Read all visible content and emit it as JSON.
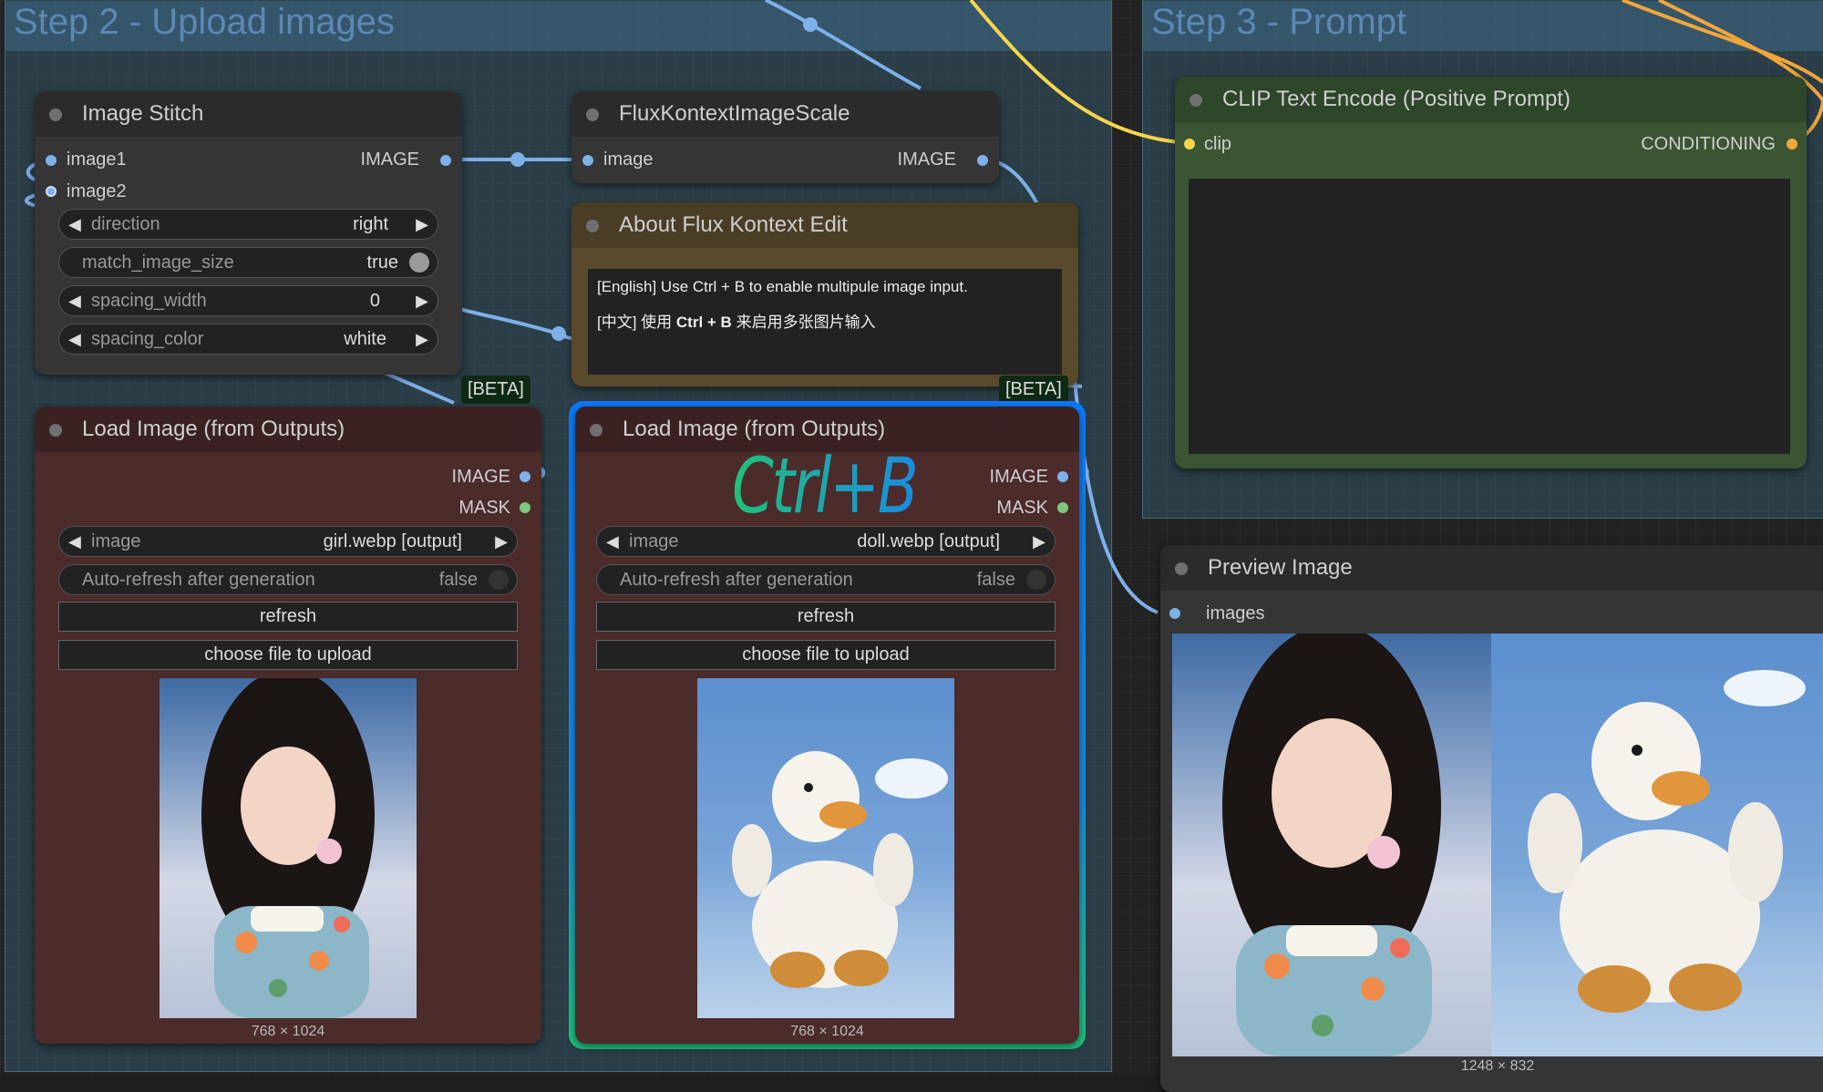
{
  "groups": {
    "step2_title": "Step 2 - Upload images",
    "step3_title": "Step 3 - Prompt"
  },
  "image_stitch": {
    "title": "Image Stitch",
    "inputs": [
      "image1",
      "image2"
    ],
    "output": "IMAGE",
    "widgets": [
      {
        "label": "direction",
        "value": "right"
      },
      {
        "label": "match_image_size",
        "value": "true"
      },
      {
        "label": "spacing_width",
        "value": "0"
      },
      {
        "label": "spacing_color",
        "value": "white"
      }
    ]
  },
  "flux_scale": {
    "title": "FluxKontextImageScale",
    "input": "image",
    "output": "IMAGE"
  },
  "about_note": {
    "title": "About Flux Kontext Edit",
    "line_en": "[English] Use Ctrl + B to enable multipule image input.",
    "line_zh_prefix": "[中文] 使用 ",
    "line_zh_bold": "Ctrl + B",
    "line_zh_suffix": " 来启用多张图片输入"
  },
  "beta_badge": "[BETA]",
  "load_left": {
    "title": "Load Image (from Outputs)",
    "out_image": "IMAGE",
    "out_mask": "MASK",
    "image_label": "image",
    "image_value": "girl.webp [output]",
    "autorefresh_label": "Auto-refresh after generation",
    "autorefresh_value": "false",
    "refresh_label": "refresh",
    "upload_label": "choose file to upload",
    "dims": "768 × 1024"
  },
  "load_right": {
    "title": "Load Image (from Outputs)",
    "out_image": "IMAGE",
    "out_mask": "MASK",
    "image_label": "image",
    "image_value": "doll.webp [output]",
    "autorefresh_label": "Auto-refresh after generation",
    "autorefresh_value": "false",
    "refresh_label": "refresh",
    "upload_label": "choose file to upload",
    "dims": "768 × 1024",
    "overlay": "Ctrl+B"
  },
  "clip": {
    "title": "CLIP Text Encode (Positive Prompt)",
    "input": "clip",
    "output": "CONDITIONING",
    "text": ""
  },
  "preview": {
    "title": "Preview Image",
    "input": "images",
    "dims": "1248 × 832"
  },
  "colors": {
    "image_link": "#7eb0ea",
    "clip_link": "#f6d64c",
    "conditioning_link": "#f3a63a",
    "mask_slot": "#7ec87e",
    "load_node_bg": "#4c2b2b",
    "note_node_bg": "#5a4a2c",
    "clip_node_bg": "#3b5534",
    "highlight_start": "#0c7bff",
    "highlight_end": "#1ec77e"
  },
  "icons": {
    "left_arrow": "◀",
    "right_arrow": "▶"
  }
}
